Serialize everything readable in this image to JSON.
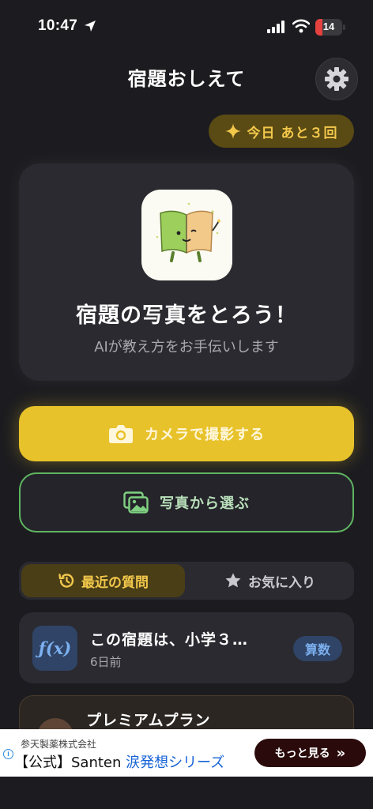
{
  "status_bar": {
    "time": "10:47",
    "battery": "14"
  },
  "header": {
    "title": "宿題おしえて"
  },
  "quota": {
    "label": "今日 あと３回"
  },
  "hero": {
    "title": "宿題の写真をとろう！",
    "subtitle": "AIが教え方をお手伝いします"
  },
  "actions": {
    "camera_label": "カメラで撮影する",
    "gallery_label": "写真から選ぶ"
  },
  "tabs": [
    {
      "label": "最近の質問",
      "selected": true
    },
    {
      "label": "お気に入り",
      "selected": false
    }
  ],
  "recent": [
    {
      "icon_text": "ƒ(x)",
      "question": "この宿題は、小学３…",
      "date": "6日前",
      "subject": "算数"
    }
  ],
  "premium": {
    "title": "プレミアムプラン"
  },
  "ad": {
    "sponsor": "参天製薬株式会社",
    "headline_prefix": "【公式】Santen ",
    "headline_highlight": "涙発想シリーズ",
    "cta": "もっと見る",
    "info": "i"
  },
  "colors": {
    "background": "#1c1c20",
    "card": "#2a2a30",
    "accent_yellow": "#e8c22a",
    "accent_green": "#5fb561",
    "subject_blue": "#7cb0f0"
  },
  "icons": [
    "location-arrow-icon",
    "cellular-signal-icon",
    "wifi-icon",
    "battery-icon",
    "gear-icon",
    "sparkle-icon",
    "camera-icon",
    "gallery-icon",
    "history-icon",
    "star-icon",
    "chevron-double-right-icon",
    "info-icon"
  ]
}
